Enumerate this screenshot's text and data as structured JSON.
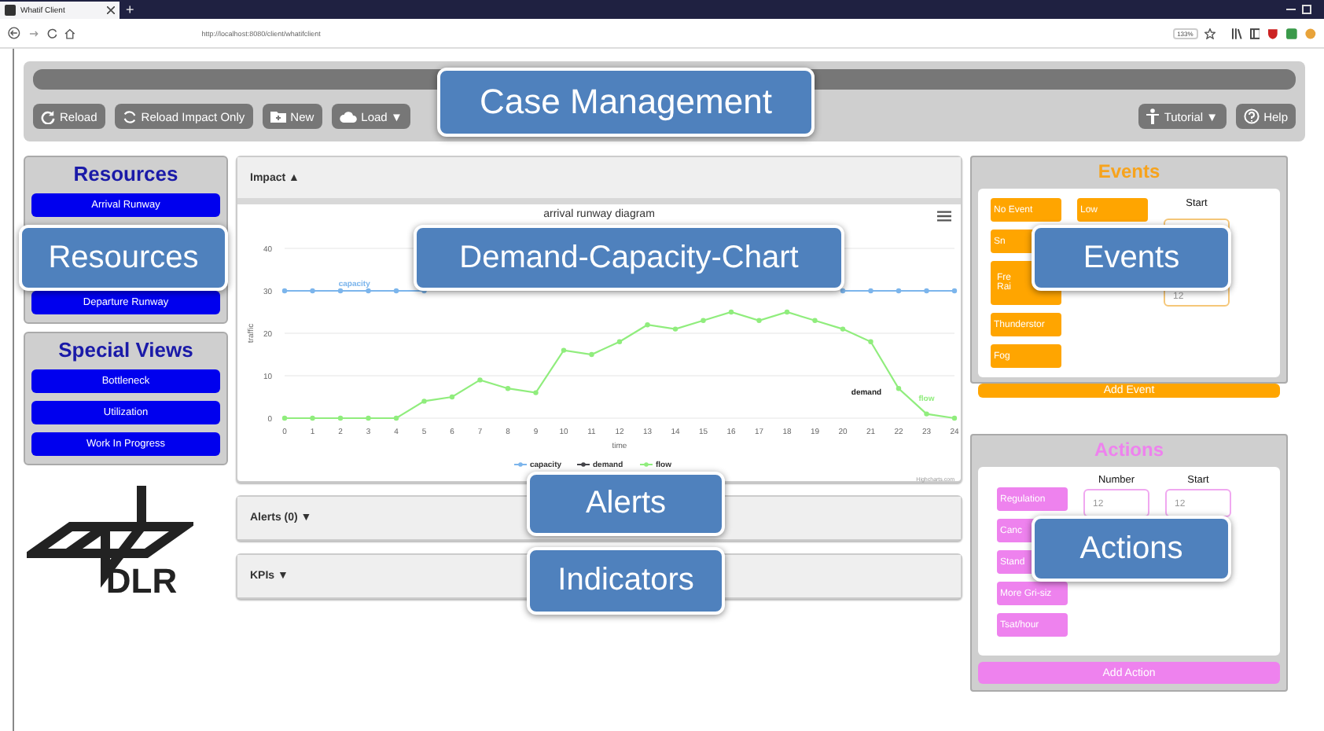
{
  "browser": {
    "tab_title": "Whatif Client",
    "new_tab": "+",
    "url": "http://localhost:8080/client/whatifclient",
    "zoom": "133%"
  },
  "toolbar": {
    "left_buttons": [
      "Reload",
      "Reload Impact Only",
      "New",
      "Load ▼"
    ],
    "right_buttons": [
      "Tutorial ▼",
      "Help"
    ]
  },
  "resources": {
    "title": "Resources",
    "items": [
      "Arrival Runway",
      "Departure Runway"
    ]
  },
  "special_views": {
    "title": "Special Views",
    "items": [
      "Bottleneck",
      "Utilization",
      "Work In Progress"
    ]
  },
  "logo": {
    "text": "DLR"
  },
  "impact": {
    "header": "Impact ▲",
    "chart_data": {
      "type": "line",
      "title": "arrival runway diagram",
      "xlabel": "time",
      "ylabel": "traffic",
      "x": [
        0,
        1,
        2,
        3,
        4,
        5,
        6,
        7,
        8,
        9,
        10,
        11,
        12,
        13,
        14,
        15,
        16,
        17,
        18,
        19,
        20,
        21,
        22,
        23,
        24
      ],
      "xlim": [
        0,
        24
      ],
      "ylim": [
        0,
        40
      ],
      "yticks": [
        0,
        10,
        20,
        30,
        40
      ],
      "xticks": [
        0,
        1,
        2,
        3,
        4,
        5,
        6,
        7,
        8,
        9,
        10,
        11,
        12,
        13,
        14,
        15,
        16,
        17,
        18,
        19,
        20,
        21,
        22,
        23,
        24
      ],
      "legend": "bottom",
      "grid": true,
      "series": [
        {
          "name": "capacity",
          "color": "#7cb5ec",
          "marker": true,
          "values": [
            30,
            30,
            30,
            30,
            30,
            30,
            null,
            null,
            null,
            null,
            null,
            null,
            null,
            null,
            null,
            null,
            null,
            null,
            null,
            null,
            30,
            30,
            30,
            30,
            30
          ]
        },
        {
          "name": "demand",
          "color": "#434348",
          "marker": true,
          "values": [
            null,
            null,
            null,
            null,
            null,
            null,
            null,
            null,
            null,
            null,
            null,
            null,
            null,
            null,
            null,
            null,
            null,
            null,
            null,
            null,
            null,
            null,
            null,
            null,
            null
          ]
        },
        {
          "name": "flow",
          "color": "#90ed7d",
          "marker": true,
          "values": [
            0,
            0,
            0,
            0,
            0,
            4,
            5,
            9,
            7,
            6,
            16,
            15,
            18,
            22,
            21,
            23,
            25,
            23,
            25,
            23,
            21,
            18,
            7,
            1,
            0
          ]
        }
      ],
      "annotations": [
        {
          "text": "capacity",
          "x": 2.5,
          "y": 30
        },
        "demand",
        {
          "text": "flow",
          "x": 23,
          "y": 3
        }
      ]
    },
    "credits": "Highcharts.com"
  },
  "alerts": {
    "header": "Alerts (0) ▼"
  },
  "kpis": {
    "header": "KPIs ▼"
  },
  "events": {
    "title": "Events",
    "types": [
      "No Event",
      "Sn",
      "Fre Rai",
      "Thunderstor",
      "Fog"
    ],
    "levels": [
      "Low"
    ],
    "start_label": "Start",
    "start_value": "12",
    "add": "Add Event"
  },
  "actions": {
    "title": "Actions",
    "types": [
      "Regulation",
      "Canc",
      "Stand",
      "More Gri-siz",
      "Tsat/hour"
    ],
    "number_label": "Number",
    "number_value": "12",
    "start_label": "Start",
    "start_value": "12",
    "add": "Add Action"
  },
  "callouts": [
    "Case Management",
    "Resources",
    "Demand-Capacity-Chart",
    "Events",
    "Alerts",
    "Indicators",
    "Actions"
  ]
}
